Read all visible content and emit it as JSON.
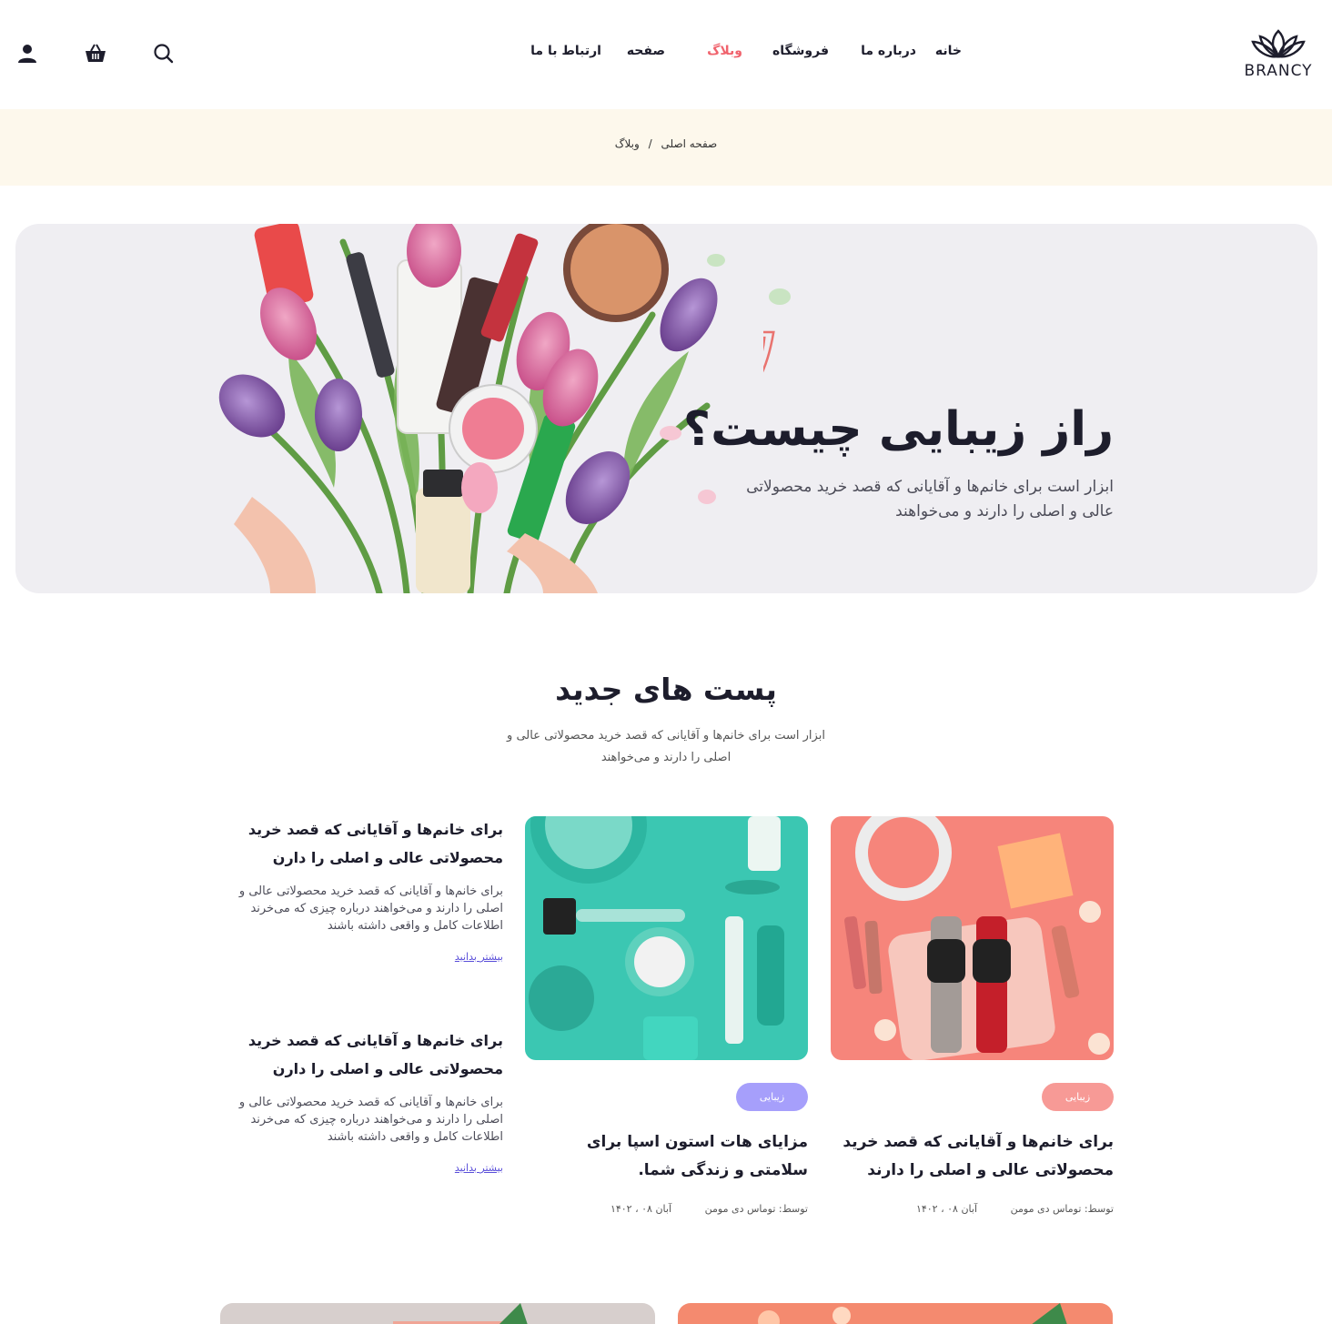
{
  "brand": {
    "logo_text": "BRANCY",
    "accent": "#f0636d"
  },
  "nav": {
    "items": [
      {
        "label": "خانه"
      },
      {
        "label": "درباره ما"
      },
      {
        "label": "فروشگاه"
      },
      {
        "label": "وبلاگ",
        "active": true
      },
      {
        "label": "صفحه"
      },
      {
        "label": "ارتباط با ما"
      }
    ],
    "icons": [
      "search-icon",
      "cart-icon",
      "user-icon"
    ]
  },
  "breadcrumb": {
    "home": "صفحه اصلی",
    "separator": "/",
    "current": "وبلاگ"
  },
  "hero": {
    "script": "Beauty",
    "title": "راز زیبایی چیست؟",
    "subtitle": "ابزار است برای خانم‌ها و آقایانی که قصد خرید محصولاتی عالی و اصلی را دارند و می‌خواهند"
  },
  "section": {
    "title": "پست های جدید",
    "subtitle": "ابزار است برای خانم‌ها و آقایانی که قصد خرید محصولاتی عالی و اصلی را دارند و می‌خواهند"
  },
  "cards": [
    {
      "badge": "زیبایی",
      "badge_color": "#f79a96",
      "title": "برای خانم‌ها و آقایانی که قصد خرید محصولاتی عالی و اصلی را دارند",
      "author": "توسط: توماس دی مومن",
      "date": "آبان ۰۸ ، ۱۴۰۲"
    },
    {
      "badge": "زیبایی",
      "badge_color": "#a69ffb",
      "title": "مزایای هات استون اسپا برای سلامتی و زندگی شما.",
      "author": "توسط: توماس دی مومن",
      "date": "آبان ۰۸ ، ۱۴۰۲"
    }
  ],
  "list_posts": [
    {
      "title": "برای خانم‌ها و آقایانی که قصد خرید محصولاتی عالی و اصلی را دارن",
      "excerpt": "برای خانم‌ها و آقایانی که قصد خرید محصولاتی عالی و اصلی را دارند و می‌خواهند درباره چیزی که می‌خرند اطلاعات کامل و واقعی داشته باشند",
      "more": "بیشتر بدانید"
    },
    {
      "title": "برای خانم‌ها و آقایانی که قصد خرید محصولاتی عالی و اصلی را دارن",
      "excerpt": "برای خانم‌ها و آقایانی که قصد خرید محصولاتی عالی و اصلی را دارند و می‌خواهند درباره چیزی که می‌خرند اطلاعات کامل و واقعی داشته باشند",
      "more": "بیشتر بدانید"
    }
  ]
}
